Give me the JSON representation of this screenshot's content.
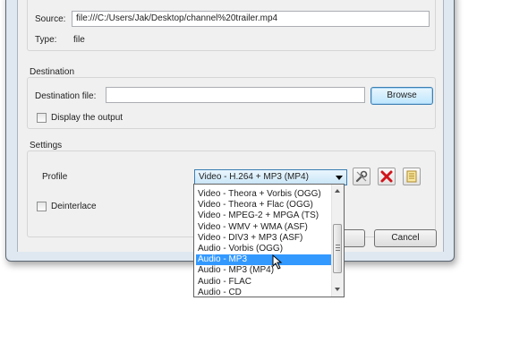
{
  "source": {
    "label": "Source:",
    "value": "file:///C:/Users/Jak/Desktop/channel%20trailer.mp4",
    "type_label": "Type:",
    "type_value": "file"
  },
  "destination": {
    "group_label": "Destination",
    "file_label": "Destination file:",
    "file_value": "",
    "browse_label": "Browse",
    "display_output_label": "Display the output",
    "display_output_checked": false
  },
  "settings": {
    "group_label": "Settings",
    "profile_label": "Profile",
    "profile_selected": "Video - H.264 + MP3 (MP4)",
    "deinterlace_label": "Deinterlace",
    "deinterlace_checked": false,
    "icons": [
      "wrench-icon",
      "delete-icon",
      "new-profile-icon"
    ]
  },
  "profile_options": [
    "Video - Theora + Vorbis (OGG)",
    "Video - Theora + Flac (OGG)",
    "Video - MPEG-2 + MPGA (TS)",
    "Video - WMV + WMA (ASF)",
    "Video - DIV3 + MP3 (ASF)",
    "Audio - Vorbis (OGG)",
    "Audio - MP3",
    "Audio - MP3 (MP4)",
    "Audio - FLAC",
    "Audio - CD"
  ],
  "highlighted_option_index": 6,
  "buttons": {
    "cancel_label": "Cancel"
  },
  "colors": {
    "highlight": "#3399ff",
    "focus_border": "#3c7fb1"
  }
}
